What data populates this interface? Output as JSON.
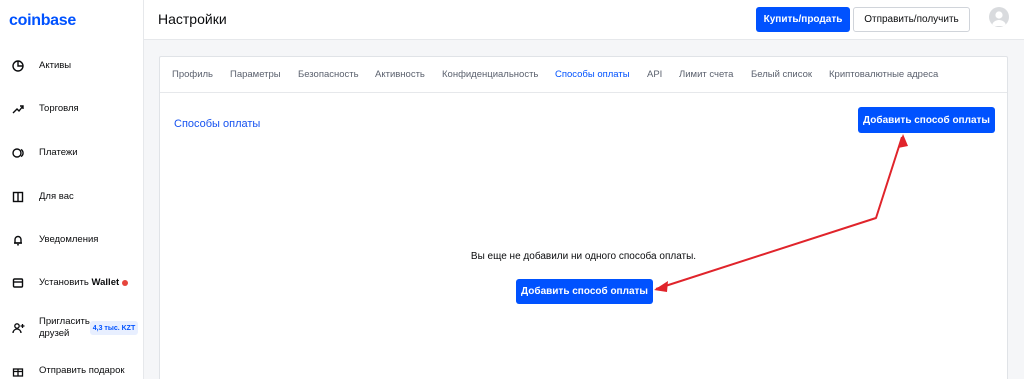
{
  "sidebar": {
    "logo": "coinbase",
    "items": [
      {
        "label": "Активы",
        "icon": "pie-chart-icon"
      },
      {
        "label": "Торговля",
        "icon": "trend-up-icon"
      },
      {
        "label": "Платежи",
        "icon": "payments-icon"
      },
      {
        "label": "Для вас",
        "icon": "book-icon"
      },
      {
        "label": "Уведомления",
        "icon": "bell-icon"
      },
      {
        "label_prefix": "Установить ",
        "label_bold": "Wallet",
        "icon": "wallet-icon"
      },
      {
        "label_line1": "Пригласить",
        "label_line2": "друзей",
        "badge": "4,3 тыс. KZT",
        "icon": "add-user-icon"
      },
      {
        "label": "Отправить подарок",
        "icon": "gift-icon"
      }
    ]
  },
  "header": {
    "title": "Настройки",
    "buy_sell_label": "Купить/продать",
    "send_receive_label": "Отправить/получить"
  },
  "tabs": [
    {
      "label": "Профиль"
    },
    {
      "label": "Параметры"
    },
    {
      "label": "Безопасность"
    },
    {
      "label": "Активность"
    },
    {
      "label": "Конфиденциальность"
    },
    {
      "label": "Способы оплаты",
      "active": true
    },
    {
      "label": "API"
    },
    {
      "label": "Лимит счета"
    },
    {
      "label": "Белый список"
    },
    {
      "label": "Криптовалютные адреса"
    }
  ],
  "payment": {
    "section_title": "Способы оплаты",
    "add_button_label": "Добавить способ оплаты",
    "empty_message": "Вы еще не добавили ни одного способа оплаты.",
    "add_button_center_label": "Добавить способ оплаты"
  },
  "colors": {
    "accent": "#0052ff",
    "annotation": "#e0242b",
    "notification_dot": "#e6453c"
  }
}
